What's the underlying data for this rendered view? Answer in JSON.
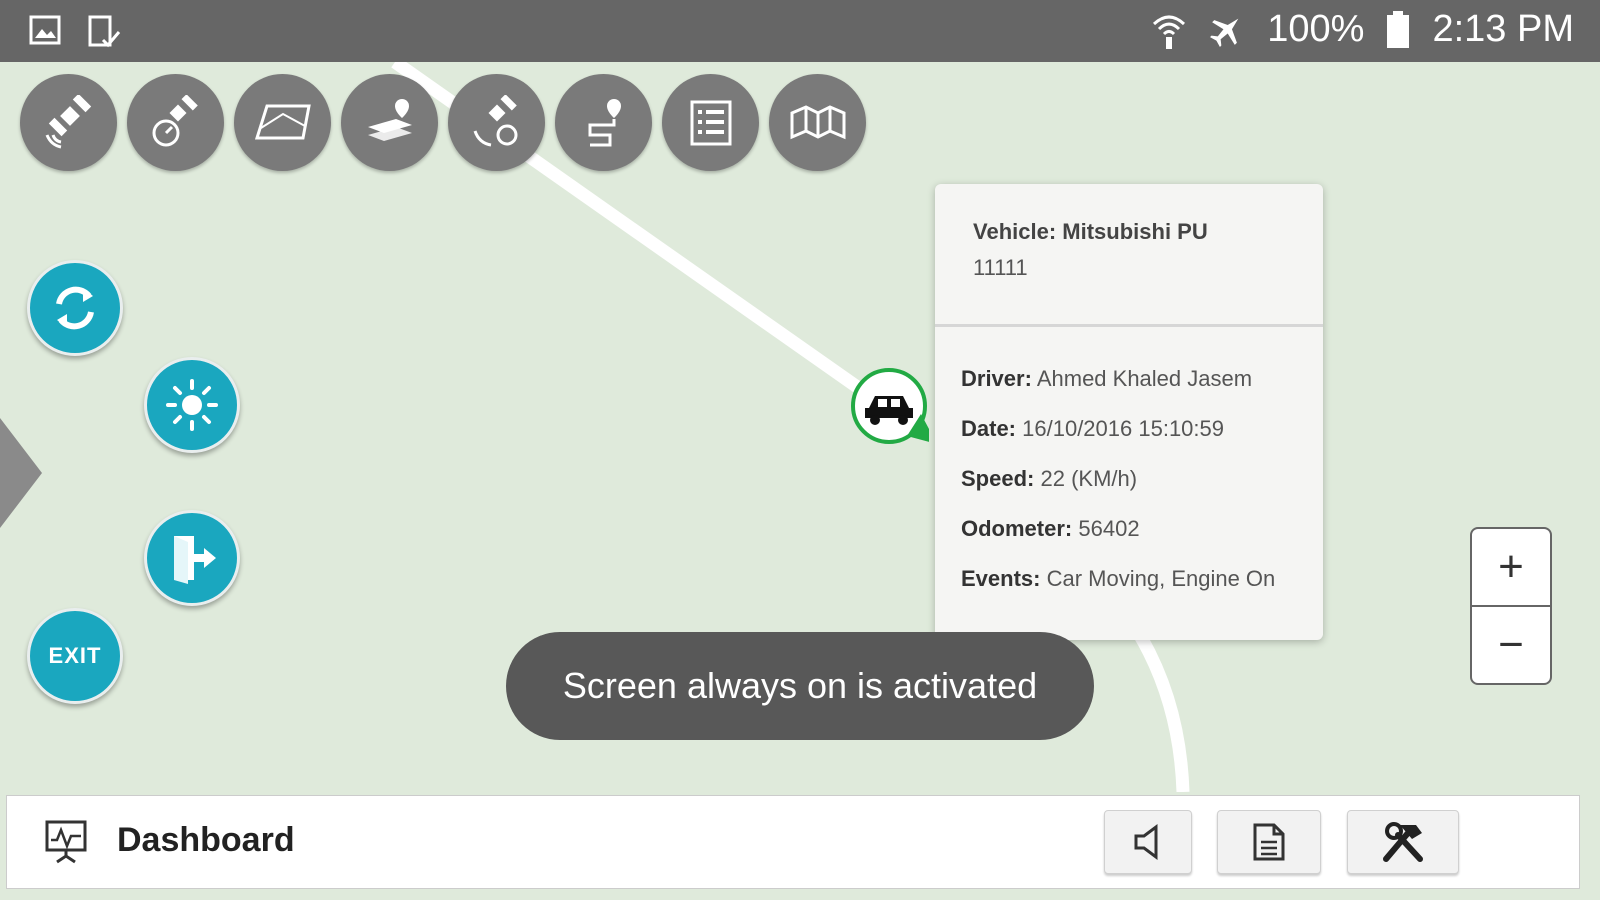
{
  "status_bar": {
    "battery_text": "100%",
    "time": "2:13 PM"
  },
  "toolbar": {
    "icons": [
      "satellite-tracking-icon",
      "satellite-speed-icon",
      "geofence-area-icon",
      "layers-location-icon",
      "satellite-refresh-icon",
      "route-path-icon",
      "list-report-icon",
      "map-view-icon"
    ]
  },
  "side_buttons": {
    "exit_label": "EXIT"
  },
  "popup": {
    "vehicle_label": "Vehicle:",
    "vehicle_value": "Mitsubishi PU",
    "vehicle_id": "11111",
    "driver_label": "Driver:",
    "driver_value": "Ahmed Khaled Jasem",
    "date_label": "Date:",
    "date_value": "16/10/2016 15:10:59",
    "speed_label": "Speed:",
    "speed_value": "22 (KM/h)",
    "odometer_label": "Odometer:",
    "odometer_value": "56402",
    "events_label": "Events:",
    "events_value": "Car Moving, Engine On"
  },
  "toast": {
    "message": "Screen always on is activated"
  },
  "zoom": {
    "plus": "+",
    "minus": "−"
  },
  "bottom_bar": {
    "title": "Dashboard"
  },
  "colors": {
    "map_bg": "#dfeadb",
    "accent": "#1aa7bf",
    "marker_ring": "#22aa44",
    "toolbar_button": "#7a7a7a",
    "status_bar": "#666666"
  }
}
